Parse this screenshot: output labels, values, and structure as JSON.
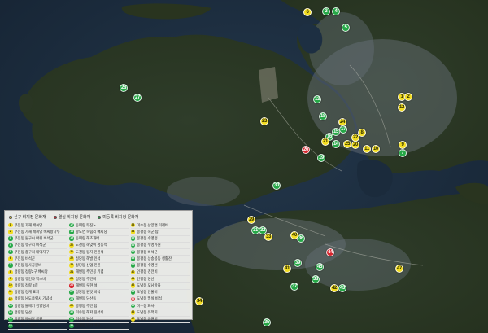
{
  "categories": {
    "new": {
      "label": "신규 비지정 문화재",
      "color": "#f2dc1f",
      "text_color": "#2a2a00"
    },
    "lost": {
      "label": "멸실 비지정 문화재",
      "color": "#d7262e",
      "text_color": "#ffffff"
    },
    "unreg": {
      "label": "미등록 비지정 문화재",
      "color": "#26a847",
      "text_color": "#ffffff"
    }
  },
  "legend": {
    "header_order": [
      "new",
      "lost",
      "unreg"
    ],
    "columns": [
      [
        {
          "num": "1",
          "cat": "new",
          "label": "무전동 가재 배씨당"
        },
        {
          "num": "2",
          "cat": "new",
          "label": "무전동 가재 배씨당 배씨향나무"
        },
        {
          "num": "3",
          "cat": "unreg",
          "label": "무전동 원구씨 바위 비석군"
        },
        {
          "num": "4",
          "cat": "unreg",
          "label": "무전동 유구리 비석군"
        },
        {
          "num": "5",
          "cat": "unreg",
          "label": "무전동 충구리 대덕지구"
        },
        {
          "num": "6",
          "cat": "new",
          "label": "무전동 비석군"
        },
        {
          "num": "7",
          "cat": "unreg",
          "label": "무전동 동사공원비"
        },
        {
          "num": "8",
          "cat": "new",
          "label": "정량동 정량2구 배씨당"
        },
        {
          "num": "9",
          "cat": "new",
          "label": "정량동 유인자 박소비"
        },
        {
          "num": "10",
          "cat": "new",
          "label": "정량동 정량 3길"
        },
        {
          "num": "11",
          "cat": "new",
          "label": "정량동 경계 표지"
        },
        {
          "num": "12",
          "cat": "new",
          "label": "정량동 남도충렬사 기념석"
        },
        {
          "num": "13",
          "cat": "unreg",
          "label": "정량동 돌배기 김영당비"
        },
        {
          "num": "14",
          "cat": "unreg",
          "label": "정량동 당산"
        },
        {
          "num": "15",
          "cat": "unreg",
          "label": "정량동 배씨당 공원"
        },
        {
          "num": "16",
          "cat": "unreg",
          "label": "정량동 이건문비"
        }
      ],
      [
        {
          "num": "17",
          "cat": "unreg",
          "label": "동피랑 무진노"
        },
        {
          "num": "18",
          "cat": "unreg",
          "label": "광도면 죽림리 배씨당"
        },
        {
          "num": "19",
          "cat": "unreg",
          "label": "동피랑 해초재배"
        },
        {
          "num": "20",
          "cat": "new",
          "label": "도천동 해맞이 성동석"
        },
        {
          "num": "21",
          "cat": "new",
          "label": "도천동 왕지 민원석"
        },
        {
          "num": "22",
          "cat": "new",
          "label": "정당동 해발 인석"
        },
        {
          "num": "23",
          "cat": "new",
          "label": "정당동 산업 민원"
        },
        {
          "num": "24",
          "cat": "new",
          "label": "해변동 주민공 기념"
        },
        {
          "num": "25",
          "cat": "new",
          "label": "정당동 주민비"
        },
        {
          "num": "26",
          "cat": "lost",
          "label": "해변동 우현 설"
        },
        {
          "num": "27",
          "cat": "unreg",
          "label": "정당동 원맛 비석"
        },
        {
          "num": "28",
          "cat": "unreg",
          "label": "해변동 당산동"
        },
        {
          "num": "29",
          "cat": "new",
          "label": "봉평동 주민 탑"
        },
        {
          "num": "30",
          "cat": "unreg",
          "label": "미수동 해저 진석비"
        },
        {
          "num": "31",
          "cat": "unreg",
          "label": "미수동 당산"
        },
        {
          "num": "32",
          "cat": "unreg",
          "label": "봉평동 민간 매장"
        }
      ],
      [
        {
          "num": "33",
          "cat": "new",
          "label": "미수동 산양면 미래비"
        },
        {
          "num": "34",
          "cat": "new",
          "label": "봉평동 해군 탑"
        },
        {
          "num": "35",
          "cat": "unreg",
          "label": "봉평동 수영정"
        },
        {
          "num": "36",
          "cat": "unreg",
          "label": "봉평동 수영가원"
        },
        {
          "num": "37",
          "cat": "unreg",
          "label": "봉평동 비석군"
        },
        {
          "num": "38",
          "cat": "unreg",
          "label": "봉평동 상송봉동 생활잔"
        },
        {
          "num": "39",
          "cat": "unreg",
          "label": "봉평동 수영선"
        },
        {
          "num": "40",
          "cat": "new",
          "label": "인평동 경전비"
        },
        {
          "num": "41",
          "cat": "new",
          "label": "인평동 당산"
        },
        {
          "num": "42",
          "cat": "new",
          "label": "도남동 도남마을"
        },
        {
          "num": "43",
          "cat": "unreg",
          "label": "도남동 인물비"
        },
        {
          "num": "44",
          "cat": "lost",
          "label": "도남동 멸실 비석"
        },
        {
          "num": "45",
          "cat": "unreg",
          "label": "미수동 화사"
        },
        {
          "num": "46",
          "cat": "new",
          "label": "도남동 유적지"
        },
        {
          "num": "47",
          "cat": "new",
          "label": "도남동 공원비"
        }
      ]
    ]
  },
  "markers": [
    {
      "num": "1",
      "cat": "new"
    },
    {
      "num": "2",
      "cat": "new"
    },
    {
      "num": "3",
      "cat": "unreg"
    },
    {
      "num": "4",
      "cat": "unreg"
    },
    {
      "num": "5",
      "cat": "unreg"
    },
    {
      "num": "6",
      "cat": "new"
    },
    {
      "num": "7",
      "cat": "unreg"
    },
    {
      "num": "8",
      "cat": "new"
    },
    {
      "num": "9",
      "cat": "new"
    },
    {
      "num": "10",
      "cat": "new"
    },
    {
      "num": "11",
      "cat": "new"
    },
    {
      "num": "12",
      "cat": "new"
    },
    {
      "num": "13",
      "cat": "unreg"
    },
    {
      "num": "14",
      "cat": "unreg"
    },
    {
      "num": "15",
      "cat": "unreg"
    },
    {
      "num": "16",
      "cat": "unreg"
    },
    {
      "num": "17",
      "cat": "unreg"
    },
    {
      "num": "18",
      "cat": "unreg"
    },
    {
      "num": "19",
      "cat": "unreg"
    },
    {
      "num": "20",
      "cat": "new"
    },
    {
      "num": "21",
      "cat": "new"
    },
    {
      "num": "22",
      "cat": "new"
    },
    {
      "num": "23",
      "cat": "new"
    },
    {
      "num": "24",
      "cat": "new"
    },
    {
      "num": "25",
      "cat": "new"
    },
    {
      "num": "26",
      "cat": "lost"
    },
    {
      "num": "27",
      "cat": "unreg"
    },
    {
      "num": "28",
      "cat": "unreg"
    },
    {
      "num": "29",
      "cat": "new"
    },
    {
      "num": "30",
      "cat": "unreg"
    },
    {
      "num": "31",
      "cat": "unreg"
    },
    {
      "num": "32",
      "cat": "unreg"
    },
    {
      "num": "33",
      "cat": "new"
    },
    {
      "num": "34",
      "cat": "new"
    },
    {
      "num": "35",
      "cat": "unreg"
    },
    {
      "num": "36",
      "cat": "unreg"
    },
    {
      "num": "37",
      "cat": "unreg"
    },
    {
      "num": "38",
      "cat": "unreg"
    },
    {
      "num": "39",
      "cat": "unreg"
    },
    {
      "num": "40",
      "cat": "new"
    },
    {
      "num": "41",
      "cat": "new"
    },
    {
      "num": "42",
      "cat": "new"
    },
    {
      "num": "43",
      "cat": "unreg"
    },
    {
      "num": "44",
      "cat": "lost"
    },
    {
      "num": "45",
      "cat": "unreg"
    },
    {
      "num": "47",
      "cat": "new"
    }
  ]
}
